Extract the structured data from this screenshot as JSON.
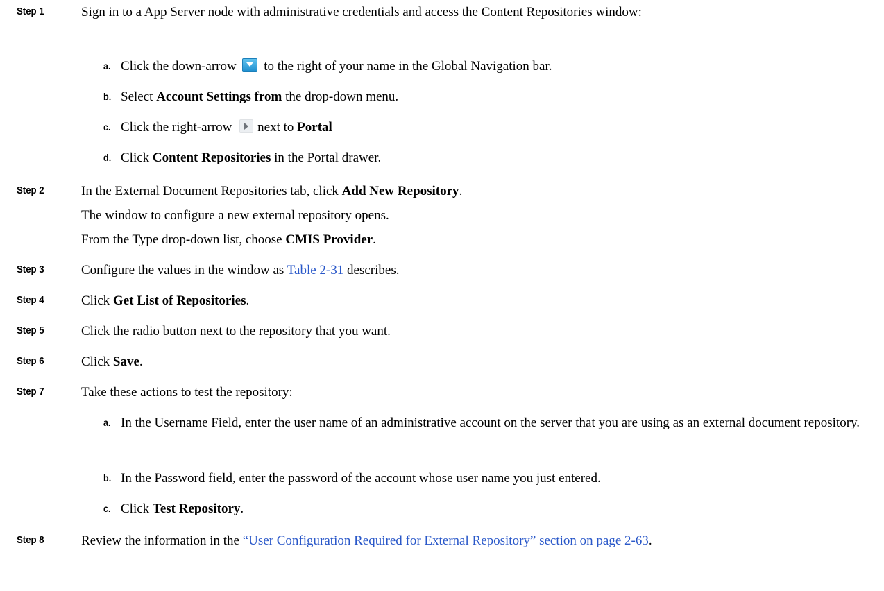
{
  "steps": [
    {
      "label": "Step 1",
      "text": "Sign in to a App Server node with administrative credentials and access the Content Repositories window:"
    },
    {
      "label": "Step 2",
      "pre": "In the External Document Repositories tab, click ",
      "bold": "Add New Repository",
      "post": ".",
      "para1": "The window to configure a new external repository opens.",
      "para2_pre": "From the Type drop-down list, choose ",
      "para2_bold": "CMIS Provider",
      "para2_post": "."
    },
    {
      "label": "Step 3",
      "pre": "Configure the values in the window as ",
      "link": "Table 2-31",
      "post": " describes."
    },
    {
      "label": "Step 4",
      "pre": "Click ",
      "bold": "Get List of Repositories",
      "post": "."
    },
    {
      "label": "Step 5",
      "text": "Click the radio button next to the repository that you want."
    },
    {
      "label": "Step 6",
      "pre": "Click ",
      "bold": "Save",
      "post": "."
    },
    {
      "label": "Step 7",
      "text": "Take these actions to test the repository:"
    },
    {
      "label": "Step 8",
      "pre": "Review the information in the ",
      "link": "“User Configuration Required for External Repository” section on page 2-63",
      "post": "."
    }
  ],
  "step1_subs": [
    {
      "label": "a.",
      "pre": "Click the down-arrow ",
      "post": " to the right of your name in the Global Navigation bar."
    },
    {
      "label": "b.",
      "pre": "Select ",
      "bold": "Account Settings from",
      "post": " the drop-down menu."
    },
    {
      "label": "c.",
      "pre": "Click the right-arrow ",
      "mid": "next to ",
      "bold": "Portal"
    },
    {
      "label": "d.",
      "pre": "Click ",
      "bold": "Content Repositories",
      "post": " in the Portal drawer."
    }
  ],
  "step7_subs": [
    {
      "label": "a.",
      "text": "In the Username Field, enter the user name of an administrative account on the server that you are using as an external document repository."
    },
    {
      "label": "b.",
      "text": "In the Password field, enter the password of the account whose user name you just entered."
    },
    {
      "label": "c.",
      "pre": "Click ",
      "bold": "Test Repository",
      "post": "."
    }
  ],
  "icons": {
    "down_arrow": "chevron-down-icon",
    "right_arrow": "triangle-right-icon"
  },
  "colors": {
    "link": "#2a58c9",
    "icon_blue": "#1f8fcf"
  }
}
